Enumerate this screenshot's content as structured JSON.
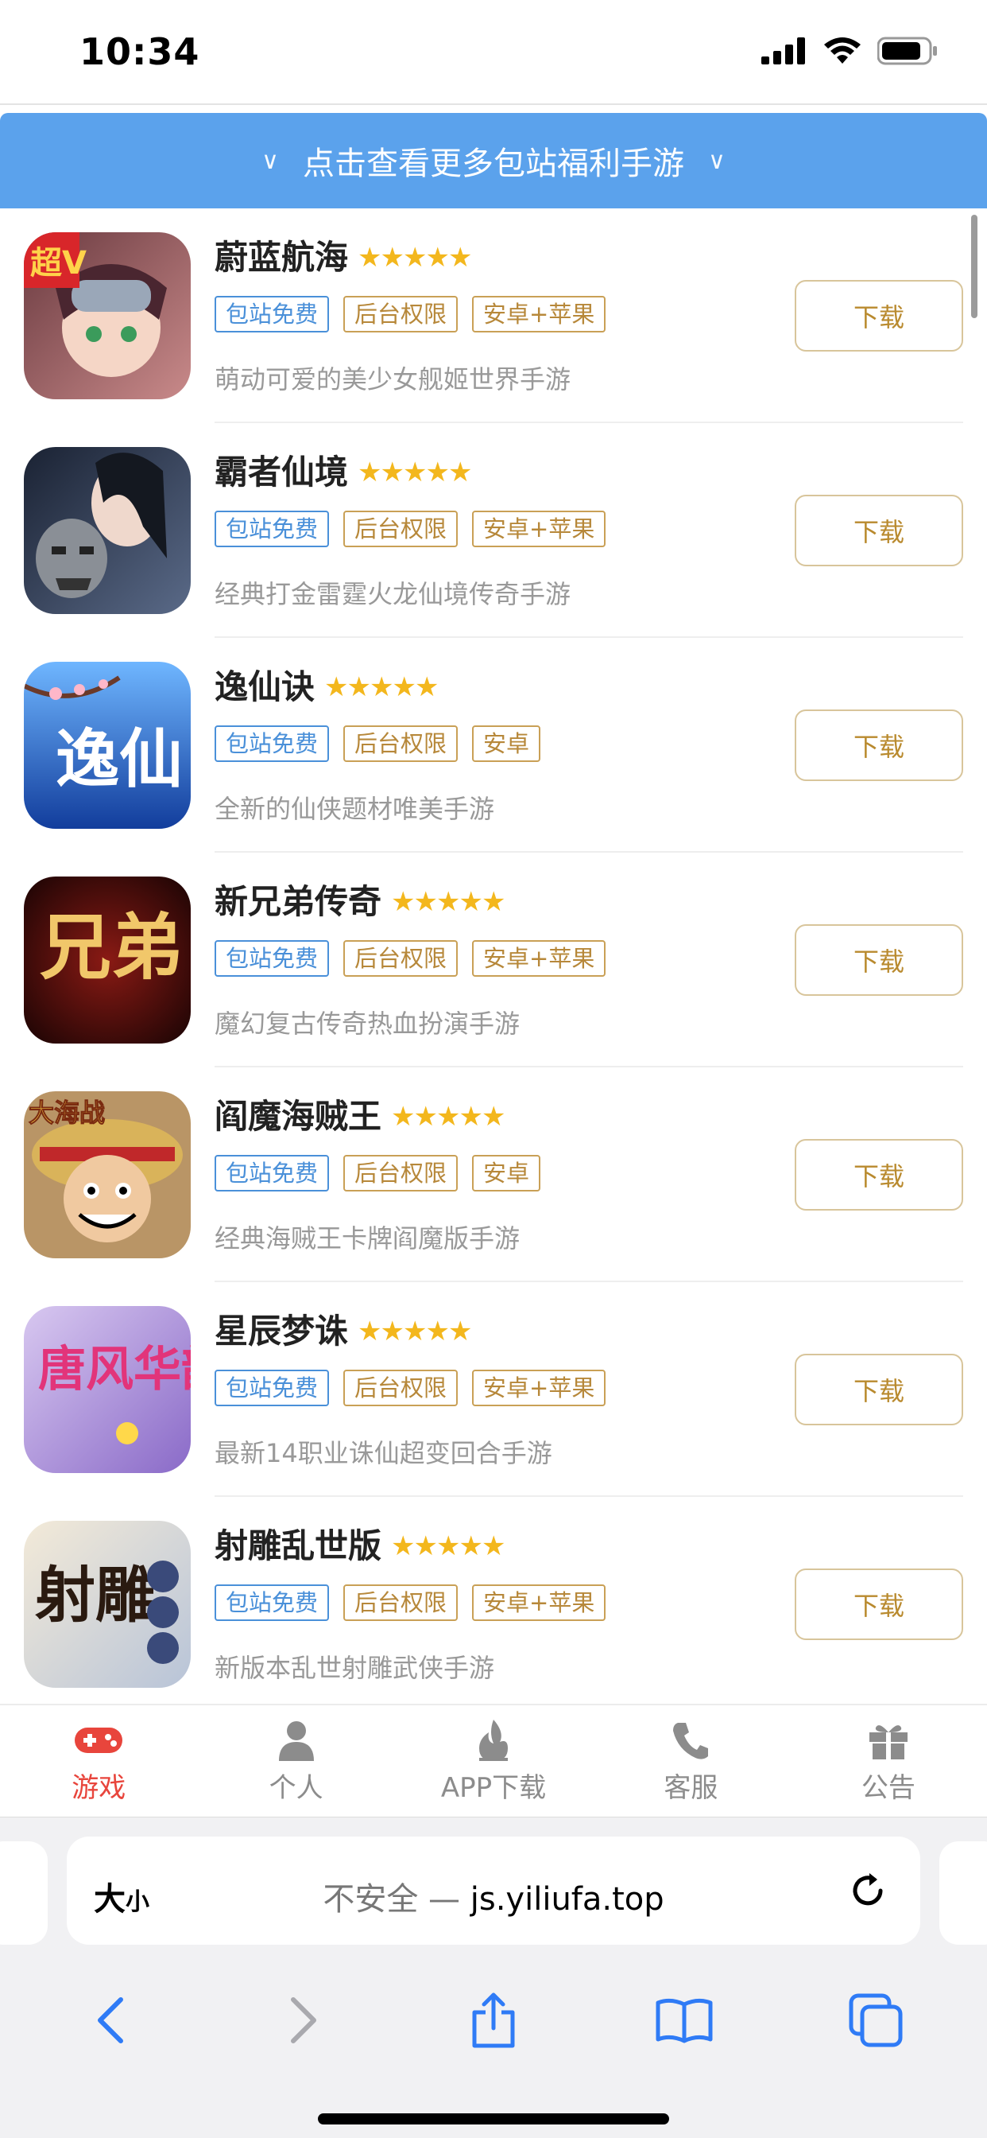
{
  "status_bar": {
    "time": "10:34",
    "signal_icon": "cellular-signal-icon",
    "wifi_icon": "wifi-icon",
    "battery_icon": "battery-icon"
  },
  "banner": {
    "text": "点击查看更多包站福利手游",
    "left_chevron": "∨",
    "right_chevron": "∨"
  },
  "games": [
    {
      "name": "蔚蓝航海",
      "stars": "★★★★★",
      "tags": [
        "包站免费",
        "后台权限",
        "安卓+苹果"
      ],
      "desc": "萌动可爱的美少女舰姬世界手游",
      "button": "下载",
      "icon_text": "超V"
    },
    {
      "name": "霸者仙境",
      "stars": "★★★★★",
      "tags": [
        "包站免费",
        "后台权限",
        "安卓+苹果"
      ],
      "desc": "经典打金雷霆火龙仙境传奇手游",
      "button": "下载",
      "icon_text": ""
    },
    {
      "name": "逸仙诀",
      "stars": "★★★★★",
      "tags": [
        "包站免费",
        "后台权限",
        "安卓"
      ],
      "desc": "全新的仙侠题材唯美手游",
      "button": "下载",
      "icon_text": "逸仙"
    },
    {
      "name": "新兄弟传奇",
      "stars": "★★★★★",
      "tags": [
        "包站免费",
        "后台权限",
        "安卓+苹果"
      ],
      "desc": "魔幻复古传奇热血扮演手游",
      "button": "下载",
      "icon_text": "兄弟"
    },
    {
      "name": "阎魔海贼王",
      "stars": "★★★★★",
      "tags": [
        "包站免费",
        "后台权限",
        "安卓"
      ],
      "desc": "经典海贼王卡牌阎魔版手游",
      "button": "下载",
      "icon_text": "大海战"
    },
    {
      "name": "星辰梦诛",
      "stars": "★★★★★",
      "tags": [
        "包站免费",
        "后台权限",
        "安卓+苹果"
      ],
      "desc": "最新14职业诛仙超变回合手游",
      "button": "下载",
      "icon_text": "唐风华韵"
    },
    {
      "name": "射雕乱世版",
      "stars": "★★★★★",
      "tags": [
        "包站免费",
        "后台权限",
        "安卓+苹果"
      ],
      "desc": "新版本乱世射雕武侠手游",
      "button": "下载",
      "icon_text": "射雕"
    }
  ],
  "tab_nav": [
    {
      "label": "游戏",
      "icon": "gamepad-icon",
      "active": true
    },
    {
      "label": "个人",
      "icon": "person-icon",
      "active": false
    },
    {
      "label": "APP下载",
      "icon": "flame-icon",
      "active": false
    },
    {
      "label": "客服",
      "icon": "phone-icon",
      "active": false
    },
    {
      "label": "公告",
      "icon": "gift-icon",
      "active": false
    }
  ],
  "safari": {
    "aa_label": "大",
    "aa_small": "小",
    "url_prefix": "不安全 — ",
    "url": "js.yiliufa.top",
    "reload_icon": "reload-icon",
    "toolbar": [
      "back-icon",
      "forward-icon",
      "share-icon",
      "bookmarks-icon",
      "tabs-icon"
    ]
  },
  "colors": {
    "banner": "#5ba2ec",
    "active_tab": "#e8453c",
    "star": "#f3b71d",
    "tag_blue": "#4a90d9",
    "tag_gold": "#b7883a",
    "button_text": "#b98a2e"
  }
}
